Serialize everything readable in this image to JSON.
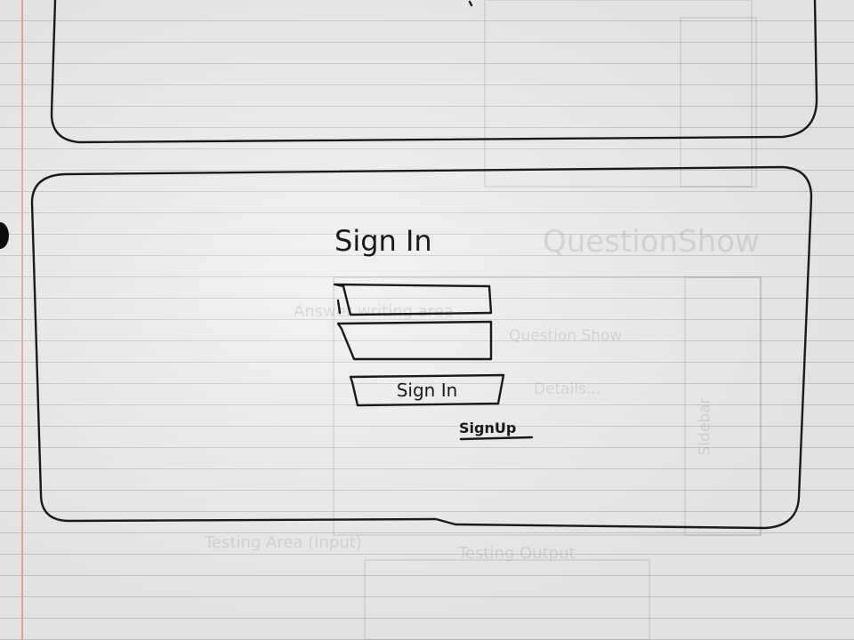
{
  "sketch": {
    "title": "Sign In",
    "username_field": {
      "value": "",
      "placeholder": ""
    },
    "password_field": {
      "value": "",
      "placeholder": ""
    },
    "submit_button_label": "Sign In",
    "signup_link_label": "SignUp"
  },
  "faint_back_page": {
    "question_show": "QuestionShow",
    "answer_writing_area": "Answer writing area",
    "question_show_small": "Question Show",
    "details": "Details...",
    "sidebar": "Sidebar",
    "testing_area": "Testing Area (Input)",
    "testing_output": "Testing Output"
  },
  "colors": {
    "paper": "#ebebe9",
    "rule_line": "#bfc6d2",
    "margin_line": "#e7a8a8",
    "ink": "#1c1a18"
  }
}
